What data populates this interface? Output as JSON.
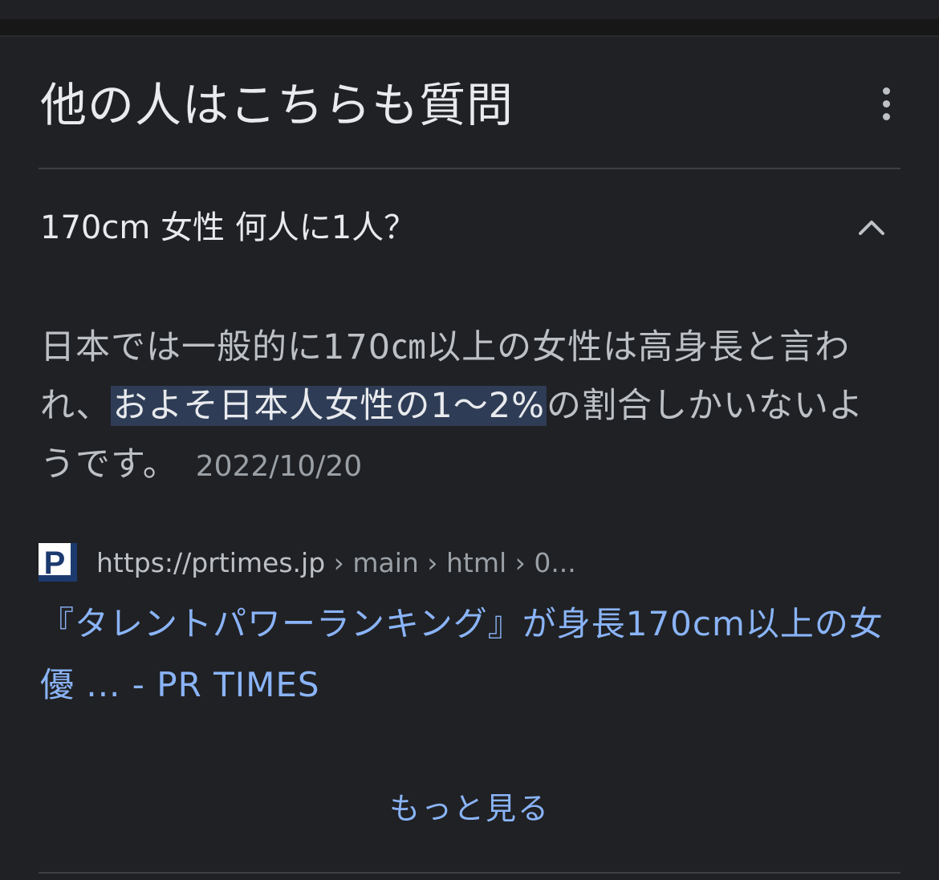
{
  "section": {
    "title": "他の人はこちらも質問",
    "more_options_icon": "more-vert-icon"
  },
  "question": {
    "text": "170cm 女性 何人に1人？",
    "expanded": true,
    "toggle_icon": "chevron-up-icon"
  },
  "answer": {
    "before": "日本では一般的に170㎝以上の女性は高身長と言われ、",
    "highlight": "およそ日本人女性の1〜2%",
    "after": "の割合しかいないようです。",
    "date": "2022/10/20"
  },
  "source": {
    "favicon_letter": "P",
    "domain": "https://prtimes.jp",
    "path": " › main › html › 0...",
    "link_title": "『タレントパワーランキング』が身長170cm以上の女優 ... - PR TIMES"
  },
  "footer": {
    "show_more_label": "もっと見る"
  },
  "colors": {
    "background": "#202124",
    "text_primary": "#e8eaed",
    "text_secondary": "#bdc1c6",
    "link": "#8ab4f8",
    "highlight_bg": "#2f3c56",
    "divider": "#3c4043",
    "favicon_blue": "#1c3a6e"
  }
}
